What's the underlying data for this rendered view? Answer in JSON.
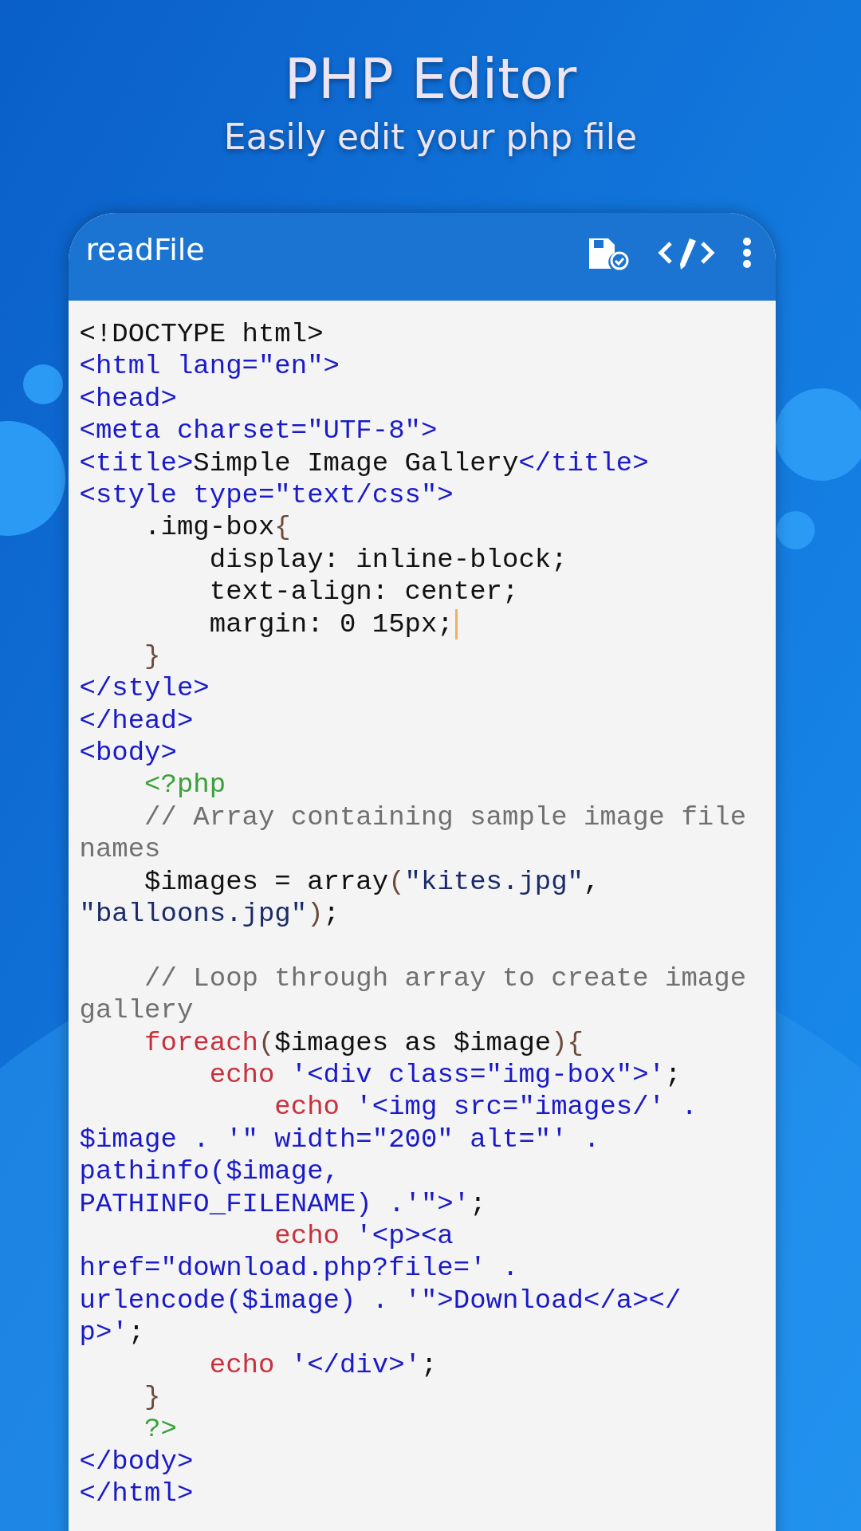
{
  "banner": {
    "title": "PHP Editor",
    "subtitle": "Easily edit your php file"
  },
  "toolbar": {
    "title": "readFile"
  },
  "code_lines": [
    {
      "kind": "code",
      "caret": false,
      "tokens": [
        {
          "kind": "plain",
          "text": "<!DOCTYPE html>"
        }
      ]
    },
    {
      "kind": "code",
      "caret": false,
      "tokens": [
        {
          "kind": "markup",
          "text": "<html lang=\"en\">"
        }
      ]
    },
    {
      "kind": "code",
      "caret": false,
      "tokens": [
        {
          "kind": "markup",
          "text": "<head>"
        }
      ]
    },
    {
      "kind": "code",
      "caret": false,
      "tokens": [
        {
          "kind": "markup",
          "text": "<meta charset=\"UTF-8\">"
        }
      ]
    },
    {
      "kind": "code",
      "caret": false,
      "tokens": [
        {
          "kind": "markup",
          "text": "<title>"
        },
        {
          "kind": "plain",
          "text": "Simple Image Gallery"
        },
        {
          "kind": "markup",
          "text": "</title>"
        }
      ]
    },
    {
      "kind": "code",
      "caret": false,
      "tokens": [
        {
          "kind": "markup",
          "text": "<style type=\"text/css\">"
        }
      ]
    },
    {
      "kind": "code",
      "caret": false,
      "tokens": [
        {
          "kind": "plain",
          "text": "    .img-box"
        },
        {
          "kind": "bracket",
          "text": "{"
        }
      ]
    },
    {
      "kind": "code",
      "caret": false,
      "tokens": [
        {
          "kind": "plain",
          "text": "        display: inline-block;"
        }
      ]
    },
    {
      "kind": "code",
      "caret": false,
      "tokens": [
        {
          "kind": "plain",
          "text": "        text-align: center;"
        }
      ]
    },
    {
      "kind": "code",
      "caret": true,
      "tokens": [
        {
          "kind": "plain",
          "text": "        margin: 0 15px;"
        }
      ]
    },
    {
      "kind": "code",
      "caret": false,
      "tokens": [
        {
          "kind": "bracket",
          "text": "    }"
        }
      ]
    },
    {
      "kind": "code",
      "caret": false,
      "tokens": [
        {
          "kind": "markup",
          "text": "</style>"
        }
      ]
    },
    {
      "kind": "code",
      "caret": false,
      "tokens": [
        {
          "kind": "markup",
          "text": "</head>"
        }
      ]
    },
    {
      "kind": "code",
      "caret": false,
      "tokens": [
        {
          "kind": "markup",
          "text": "<body>"
        }
      ]
    },
    {
      "kind": "code",
      "caret": false,
      "tokens": [
        {
          "kind": "php",
          "text": "    <?php"
        }
      ]
    },
    {
      "kind": "code",
      "caret": false,
      "tokens": [
        {
          "kind": "comment",
          "text": "    // Array containing sample image file"
        }
      ]
    },
    {
      "kind": "code",
      "caret": false,
      "tokens": [
        {
          "kind": "comment",
          "text": "names"
        }
      ]
    },
    {
      "kind": "code",
      "caret": false,
      "tokens": [
        {
          "kind": "plain",
          "text": "    $images = array"
        },
        {
          "kind": "bracket",
          "text": "("
        },
        {
          "kind": "string",
          "text": "\"kites.jpg\""
        },
        {
          "kind": "plain",
          "text": ","
        }
      ]
    },
    {
      "kind": "code",
      "caret": false,
      "tokens": [
        {
          "kind": "string",
          "text": "\"balloons.jpg\""
        },
        {
          "kind": "bracket",
          "text": ")"
        },
        {
          "kind": "plain",
          "text": ";"
        }
      ]
    },
    {
      "kind": "blank"
    },
    {
      "kind": "code",
      "caret": false,
      "tokens": [
        {
          "kind": "comment",
          "text": "    // Loop through array to create image"
        }
      ]
    },
    {
      "kind": "code",
      "caret": false,
      "tokens": [
        {
          "kind": "comment",
          "text": "gallery"
        }
      ]
    },
    {
      "kind": "code",
      "caret": false,
      "tokens": [
        {
          "kind": "keyword",
          "text": "    foreach"
        },
        {
          "kind": "bracket",
          "text": "("
        },
        {
          "kind": "plain",
          "text": "$images as $image"
        },
        {
          "kind": "bracket",
          "text": "){"
        }
      ]
    },
    {
      "kind": "code",
      "caret": false,
      "tokens": [
        {
          "kind": "keyword",
          "text": "        echo"
        },
        {
          "kind": "markup",
          "text": " '<div class=\"img-box\">'"
        },
        {
          "kind": "plain",
          "text": ";"
        }
      ]
    },
    {
      "kind": "code",
      "caret": false,
      "tokens": [
        {
          "kind": "keyword",
          "text": "            echo"
        },
        {
          "kind": "markup",
          "text": " '<img src=\"images/' ."
        }
      ]
    },
    {
      "kind": "code",
      "caret": false,
      "tokens": [
        {
          "kind": "markup",
          "text": "$image . '\" width=\"200\" alt=\"' ."
        }
      ]
    },
    {
      "kind": "code",
      "caret": false,
      "tokens": [
        {
          "kind": "markup",
          "text": "pathinfo($image,"
        }
      ]
    },
    {
      "kind": "code",
      "caret": false,
      "tokens": [
        {
          "kind": "markup",
          "text": "PATHINFO_FILENAME) .'\">'"
        },
        {
          "kind": "plain",
          "text": ";"
        }
      ]
    },
    {
      "kind": "code",
      "caret": false,
      "tokens": [
        {
          "kind": "keyword",
          "text": "            echo"
        },
        {
          "kind": "markup",
          "text": " '<p><a"
        }
      ]
    },
    {
      "kind": "code",
      "caret": false,
      "tokens": [
        {
          "kind": "markup",
          "text": "href=\"download.php?file=' ."
        }
      ]
    },
    {
      "kind": "code",
      "caret": false,
      "tokens": [
        {
          "kind": "markup",
          "text": "urlencode($image) . '\">Download</a></"
        }
      ]
    },
    {
      "kind": "code",
      "caret": false,
      "tokens": [
        {
          "kind": "markup",
          "text": "p>'"
        },
        {
          "kind": "plain",
          "text": ";"
        }
      ]
    },
    {
      "kind": "code",
      "caret": false,
      "tokens": [
        {
          "kind": "keyword",
          "text": "        echo"
        },
        {
          "kind": "markup",
          "text": " '</div>'"
        },
        {
          "kind": "plain",
          "text": ";"
        }
      ]
    },
    {
      "kind": "code",
      "caret": false,
      "tokens": [
        {
          "kind": "bracket",
          "text": "    }"
        }
      ]
    },
    {
      "kind": "code",
      "caret": false,
      "tokens": [
        {
          "kind": "php",
          "text": "    ?>"
        }
      ]
    },
    {
      "kind": "code",
      "caret": false,
      "tokens": [
        {
          "kind": "markup",
          "text": "</body>"
        }
      ]
    },
    {
      "kind": "code",
      "caret": false,
      "tokens": [
        {
          "kind": "markup",
          "text": "</html>"
        }
      ]
    }
  ]
}
